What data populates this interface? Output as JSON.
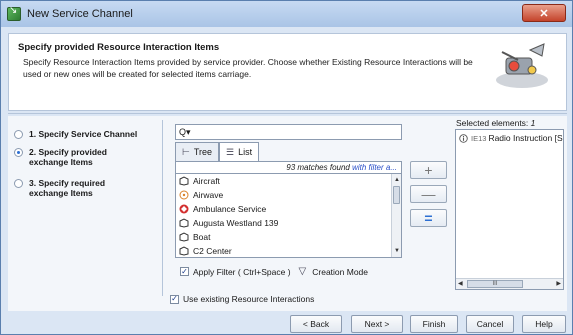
{
  "window": {
    "title": "New Service Channel",
    "close_symbol": "✕"
  },
  "header": {
    "title": "Specify provided Resource Interaction Items",
    "description": "Specify Resource Interaction Items provided by service provider. Choose whether Existing Resource Interactions will be used or new ones will be created for selected items carriage."
  },
  "steps": [
    {
      "label": "1. Specify Service Channel",
      "selected": false
    },
    {
      "label": "2. Specify provided exchange Items",
      "selected": true
    },
    {
      "label": "3. Specify required exchange Items",
      "selected": false
    }
  ],
  "search": {
    "placeholder": "Q▾",
    "value": ""
  },
  "tabs": [
    {
      "label": "Tree",
      "icon": "tree-icon",
      "active": false
    },
    {
      "label": "List",
      "icon": "list-icon",
      "active": true
    }
  ],
  "matches": {
    "count_text": "93 matches found ",
    "filter_link": "with filter a..."
  },
  "list_items": [
    {
      "label": "Aircraft",
      "icon": "block-icon"
    },
    {
      "label": "Airwave",
      "icon": "signal-icon"
    },
    {
      "label": "Ambulance Service",
      "icon": "service-icon"
    },
    {
      "label": "Augusta Westland 139",
      "icon": "block-icon"
    },
    {
      "label": "Boat",
      "icon": "block-icon"
    },
    {
      "label": "C2 Center",
      "icon": "block-icon"
    }
  ],
  "filter": {
    "label": "Apply Filter ( Ctrl+Space )",
    "checked": true,
    "mode_label": "Creation Mode"
  },
  "use_existing": {
    "label": "Use existing Resource Interactions",
    "checked": true
  },
  "mid_buttons": {
    "add": "+",
    "remove": "—",
    "remove_all": "="
  },
  "selected": {
    "label_prefix": "Selected elements: ",
    "count": "1",
    "items": [
      {
        "stereotype": "IE13",
        "label": "Radio Instruction [S"
      }
    ],
    "hscroll_thumb": "III"
  },
  "footer": {
    "back": "< Back",
    "next": "Next >",
    "finish": "Finish",
    "cancel": "Cancel",
    "help": "Help"
  },
  "colors": {
    "accent": "#2d6fd2",
    "link": "#2a4fc9",
    "chrome": "#dbe6f4",
    "close": "#c4432b"
  }
}
